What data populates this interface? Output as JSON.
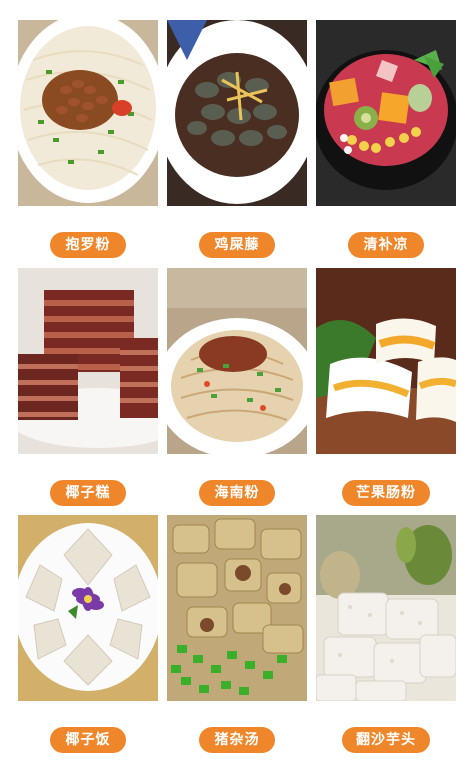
{
  "accent_color": "#f0862a",
  "items": [
    {
      "label": "抱罗粉",
      "icon": "noodle-soup-image"
    },
    {
      "label": "鸡屎藤",
      "icon": "dumpling-soup-image"
    },
    {
      "label": "清补凉",
      "icon": "fruit-dessert-image"
    },
    {
      "label": "椰子糕",
      "icon": "layered-cake-image"
    },
    {
      "label": "海南粉",
      "icon": "mixed-noodles-image"
    },
    {
      "label": "芒果肠粉",
      "icon": "mango-rice-roll-image"
    },
    {
      "label": "椰子饭",
      "icon": "coconut-rice-image"
    },
    {
      "label": "猪杂汤",
      "icon": "pork-offal-soup-image"
    },
    {
      "label": "翻沙芋头",
      "icon": "sugar-taro-image"
    }
  ]
}
